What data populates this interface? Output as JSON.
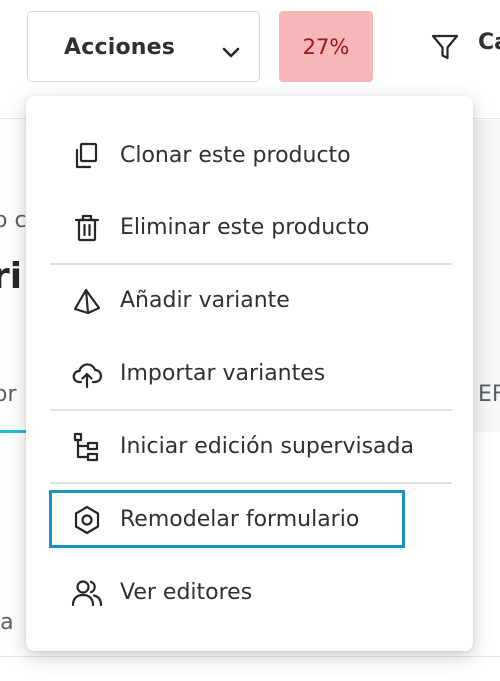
{
  "toolbar": {
    "actions_label": "Acciones",
    "completion_badge": "27%",
    "filter_label_partial": "Ca"
  },
  "background": {
    "fragment_1": "o c",
    "fragment_2": "ri",
    "fragment_3": "or",
    "fragment_4": "EF",
    "fragment_5": "ia"
  },
  "menu": {
    "items": [
      {
        "label": "Clonar este producto",
        "icon": "clone-icon"
      },
      {
        "label": "Eliminar este producto",
        "icon": "trash-icon"
      },
      {
        "label": "Añadir variante",
        "icon": "add-variant-icon"
      },
      {
        "label": "Importar variantes",
        "icon": "cloud-upload-icon"
      },
      {
        "label": "Iniciar edición supervisada",
        "icon": "workflow-tree-icon"
      },
      {
        "label": "Remodelar formulario",
        "icon": "hexagon-settings-icon"
      },
      {
        "label": "Ver editores",
        "icon": "users-icon"
      }
    ]
  },
  "colors": {
    "badge_bg": "#f5b7b7",
    "badge_text": "#a0141c",
    "focus_ring": "#1a93c4",
    "accent": "#25b9d7"
  }
}
